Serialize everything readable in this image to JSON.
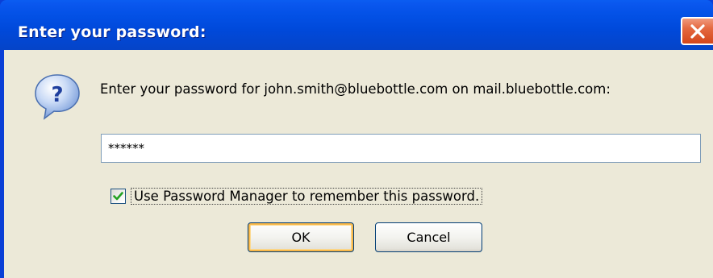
{
  "window": {
    "title": "Enter your password:",
    "close_icon": "close-icon"
  },
  "dialog": {
    "icon": "question-icon",
    "prompt": "Enter your password for john.smith@bluebottle.com on mail.bluebottle.com:",
    "password_value": "******",
    "remember_checked": true,
    "remember_label": "Use Password Manager to remember this password.",
    "ok_label": "OK",
    "cancel_label": "Cancel"
  },
  "colors": {
    "titlebar": "#0351e6",
    "dialog_bg": "#ece9d8",
    "close_button": "#d4461a",
    "default_button_focus": "#f8b84a"
  }
}
